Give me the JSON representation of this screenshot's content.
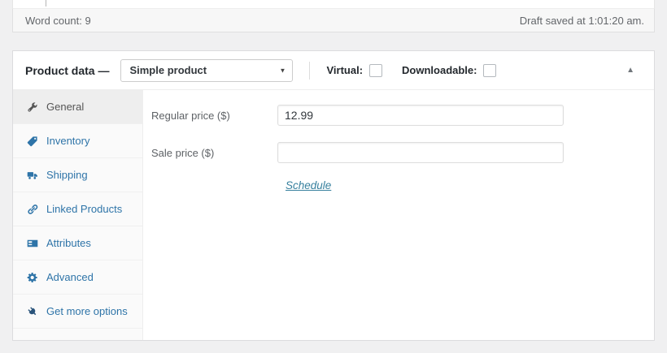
{
  "editor_statusbar": {
    "word_count": "Word count: 9",
    "draft_saved": "Draft saved at 1:01:20 am."
  },
  "product_data": {
    "title": "Product data —",
    "product_type_select": {
      "value": "Simple product"
    },
    "virtual": {
      "label": "Virtual:",
      "checked": false
    },
    "downloadable": {
      "label": "Downloadable:",
      "checked": false
    },
    "collapse_arrow": "▲",
    "select_arrow": "▼",
    "tabs": [
      {
        "slug": "general",
        "label": "General",
        "icon": "wrench-icon",
        "active": true
      },
      {
        "slug": "inventory",
        "label": "Inventory",
        "icon": "tag-icon",
        "active": false
      },
      {
        "slug": "shipping",
        "label": "Shipping",
        "icon": "truck-icon",
        "active": false
      },
      {
        "slug": "linked-products",
        "label": "Linked Products",
        "icon": "link-icon",
        "active": false
      },
      {
        "slug": "attributes",
        "label": "Attributes",
        "icon": "card-icon",
        "active": false
      },
      {
        "slug": "advanced",
        "label": "Advanced",
        "icon": "gear-icon",
        "active": false
      },
      {
        "slug": "get-more-options",
        "label": "Get more options",
        "icon": "plug-icon",
        "active": false
      }
    ],
    "general_panel": {
      "regular_price": {
        "label": "Regular price ($)",
        "value": "12.99"
      },
      "sale_price": {
        "label": "Sale price ($)",
        "value": ""
      },
      "schedule_link": "Schedule"
    }
  },
  "colors": {
    "tab_link": "#2e74a8",
    "schedule_link": "#37809e",
    "active_tab_bg": "#eeeeee",
    "active_tab_text": "#555555"
  }
}
